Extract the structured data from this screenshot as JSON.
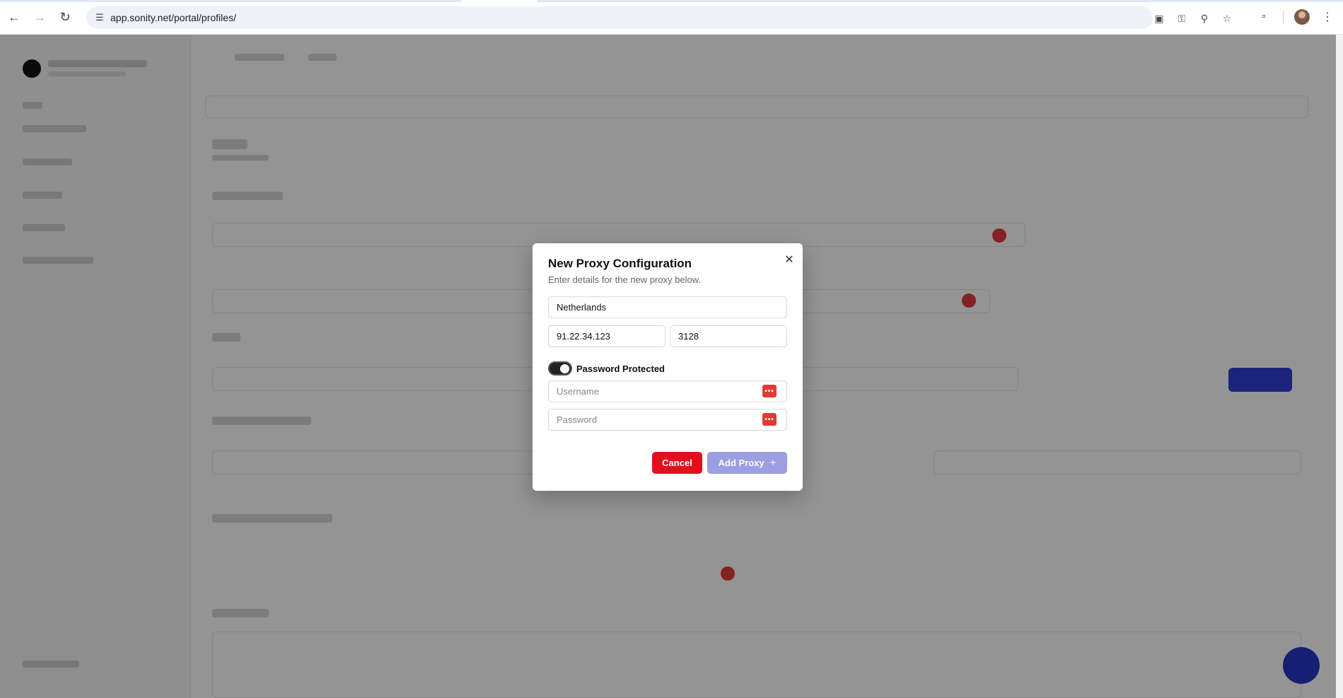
{
  "browser": {
    "url": "app.sonity.net/portal/profiles/"
  },
  "modal": {
    "title": "New Proxy Configuration",
    "subtitle": "Enter details for the new proxy below.",
    "fields": {
      "name_value": "Netherlands",
      "host_value": "91.22.34.123",
      "port_value": "3128",
      "username_placeholder": "Username",
      "password_placeholder": "Password"
    },
    "toggle": {
      "label": "Password Protected",
      "on": true
    },
    "buttons": {
      "cancel": "Cancel",
      "add": "Add Proxy"
    },
    "icons": {
      "close": "close-icon",
      "add": "plus-icon",
      "password_manager": "password-manager-icon"
    }
  },
  "colors": {
    "cancel": "#e0101f",
    "add_disabled": "#9b9ee0",
    "toggle_on": "#222222",
    "fab": "#2536c9"
  }
}
